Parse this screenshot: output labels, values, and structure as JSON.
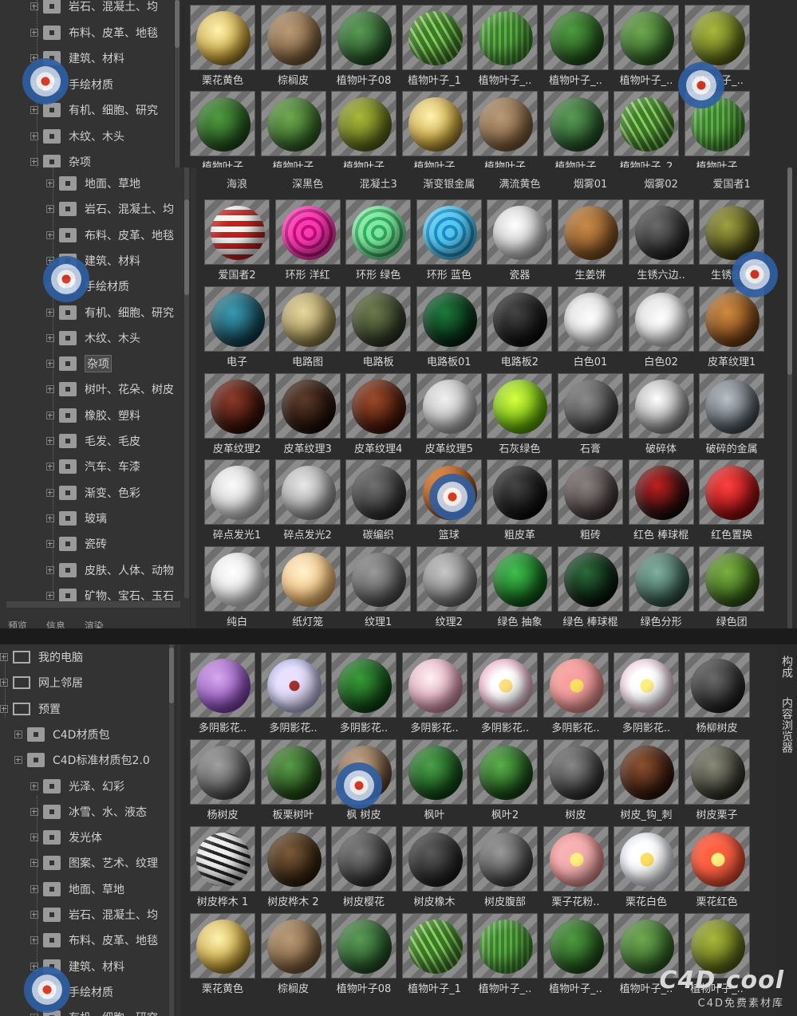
{
  "panel_top": {
    "tree": [
      "岩石、混凝土、均",
      "布料、皮革、地毯",
      "建筑、材料",
      "手绘材质",
      "有机、细胞、研究",
      "木纹、木头",
      "杂项"
    ],
    "row1": [
      "栗花黄色",
      "棕榈皮",
      "植物叶子08",
      "植物叶子_1",
      "植物叶子_..",
      "植物叶子_..",
      "植物叶子_..",
      "植物叶子_.."
    ],
    "row2": [
      "植物叶子",
      "植物叶子",
      "植物叶子",
      "植物叶子",
      "植物叶子",
      "植物叶子",
      "植物叶子_2",
      "植物叶子"
    ]
  },
  "panel_mid": {
    "tree": [
      "地面、草地",
      "岩石、混凝土、均",
      "布料、皮革、地毯",
      "建筑、材料",
      "手绘材质",
      "有机、细胞、研究",
      "木纹、木头",
      "杂项",
      "树叶、花朵、树皮",
      "橡胶、塑料",
      "毛发、毛皮",
      "汽车、车漆",
      "渐变、色彩",
      "玻璃",
      "瓷砖",
      "皮肤、人体、动物",
      "矿物、宝石、玉石"
    ],
    "selected": "杂项",
    "tabs": [
      "预览",
      "信息",
      "渲染"
    ],
    "caption_strip": [
      "海浪",
      "深黑色",
      "混凝土3",
      "渐变银金属",
      "满流黄色",
      "烟雾01",
      "烟雾02",
      "爱国者1"
    ],
    "rows": [
      [
        "爱国者2",
        "环形 洋红",
        "环形 绿色",
        "环形 蓝色",
        "瓷器",
        "生姜饼",
        "生锈六边..",
        "生锈金属"
      ],
      [
        "电子",
        "电路图",
        "电路板",
        "电路板01",
        "电路板2",
        "白色01",
        "白色02",
        "皮革纹理1"
      ],
      [
        "皮革纹理2",
        "皮革纹理3",
        "皮革纹理4",
        "皮革纹理5",
        "石灰绿色",
        "石膏",
        "破碎体",
        "破碎的金属"
      ],
      [
        "碎点发光1",
        "碎点发光2",
        "碳编织",
        "篮球",
        "粗皮革",
        "粗砖",
        "红色 棒球棍",
        "红色置换"
      ],
      [
        "纯白",
        "纸灯笼",
        "纹理1",
        "纹理2",
        "绿色 抽象",
        "绿色 棒球棍",
        "绿色分形",
        "绿色团"
      ]
    ]
  },
  "panel_bot": {
    "tree": [
      {
        "label": "我的电脑",
        "icon": "monitor-icon"
      },
      {
        "label": "网上邻居",
        "icon": "network-icon"
      },
      {
        "label": "预置",
        "icon": "preset-icon"
      },
      {
        "label": "C4D材质包",
        "icon": "folder-icon"
      },
      {
        "label": "C4D标准材质包2.0",
        "icon": "folder-open-icon"
      },
      {
        "label": "光泽、幻彩",
        "icon": "folder-icon"
      },
      {
        "label": "冰雪、水、液态",
        "icon": "folder-icon"
      },
      {
        "label": "发光体",
        "icon": "folder-icon"
      },
      {
        "label": "图案、艺术、纹理",
        "icon": "folder-icon"
      },
      {
        "label": "地面、草地",
        "icon": "folder-icon"
      },
      {
        "label": "岩石、混凝土、均",
        "icon": "folder-icon"
      },
      {
        "label": "布料、皮革、地毯",
        "icon": "folder-icon"
      },
      {
        "label": "建筑、材料",
        "icon": "folder-icon"
      },
      {
        "label": "手绘材质",
        "icon": "folder-icon"
      },
      {
        "label": "有机、细胞、研究",
        "icon": "folder-icon"
      }
    ],
    "rows": [
      [
        "多阴影花..",
        "多阴影花..",
        "多阴影花..",
        "多阴影花..",
        "多阴影花..",
        "多阴影花..",
        "多阴影花..",
        "杨柳树皮"
      ],
      [
        "杨树皮",
        "板栗树叶",
        "枫 树皮",
        "枫叶",
        "枫叶2",
        "树皮",
        "树皮_钩_刺",
        "树皮栗子"
      ],
      [
        "树皮桦木 1",
        "树皮桦木 2",
        "树皮樱花",
        "树皮橡木",
        "树皮腹部",
        "栗子花粉..",
        "栗花白色",
        "栗花红色"
      ],
      [
        "栗花黄色",
        "棕榈皮",
        "植物叶子08",
        "植物叶子_1",
        "植物叶子_..",
        "植物叶子_..",
        "植物叶子_..",
        "植物叶子_.."
      ]
    ],
    "side_tabs": [
      "构成",
      "内容浏览器"
    ]
  },
  "watermark": {
    "logo": "C4D.cool",
    "sub": "C4D免费素材库"
  },
  "colors": {
    "panel": "#333333",
    "grid": "#2c2c2c",
    "text": "#d8d8d8"
  }
}
